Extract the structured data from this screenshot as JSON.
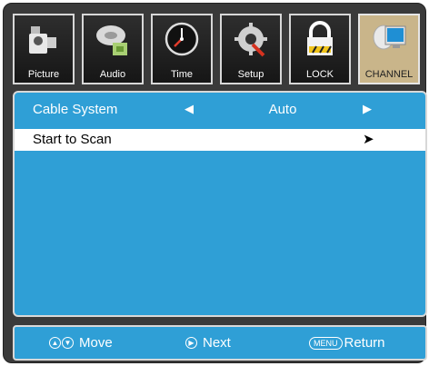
{
  "tabs": [
    {
      "label": "Picture",
      "icon": "picture-icon"
    },
    {
      "label": "Audio",
      "icon": "audio-icon"
    },
    {
      "label": "Time",
      "icon": "clock-icon"
    },
    {
      "label": "Setup",
      "icon": "setup-icon"
    },
    {
      "label": "LOCK",
      "icon": "lock-icon"
    },
    {
      "label": "CHANNEL",
      "icon": "channel-icon",
      "active": true
    }
  ],
  "menu": {
    "cable_system_label": "Cable System",
    "cable_system_value": "Auto",
    "start_scan_label": "Start to Scan"
  },
  "footer": {
    "move": "Move",
    "next": "Next",
    "menu_key": "MENU",
    "return": "Return"
  },
  "colors": {
    "panel": "#2f9fd6",
    "active_tab": "#c9b58a",
    "frame": "#3a3a3a"
  }
}
